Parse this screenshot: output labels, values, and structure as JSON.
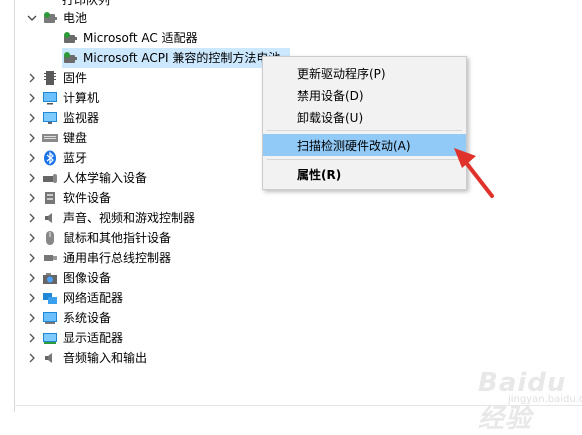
{
  "tree": {
    "cutoff_label": "打印队列",
    "battery": {
      "label": "电池",
      "children": [
        "Microsoft AC 适配器",
        "Microsoft ACPI 兼容的控制方法电池"
      ]
    },
    "categories": [
      {
        "label": "固件",
        "icon": "firmware-icon"
      },
      {
        "label": "计算机",
        "icon": "computer-icon"
      },
      {
        "label": "监视器",
        "icon": "monitor-icon"
      },
      {
        "label": "键盘",
        "icon": "keyboard-icon"
      },
      {
        "label": "蓝牙",
        "icon": "bluetooth-icon"
      },
      {
        "label": "人体学输入设备",
        "icon": "hid-icon"
      },
      {
        "label": "软件设备",
        "icon": "software-device-icon"
      },
      {
        "label": "声音、视频和游戏控制器",
        "icon": "speaker-icon"
      },
      {
        "label": "鼠标和其他指针设备",
        "icon": "mouse-icon"
      },
      {
        "label": "通用串行总线控制器",
        "icon": "usb-icon"
      },
      {
        "label": "图像设备",
        "icon": "camera-icon"
      },
      {
        "label": "网络适配器",
        "icon": "network-icon"
      },
      {
        "label": "系统设备",
        "icon": "system-device-icon"
      },
      {
        "label": "显示适配器",
        "icon": "display-adapter-icon"
      },
      {
        "label": "音频输入和输出",
        "icon": "audio-icon"
      }
    ]
  },
  "context_menu": {
    "items": [
      {
        "label": "更新驱动程序(P)"
      },
      {
        "label": "禁用设备(D)"
      },
      {
        "label": "卸载设备(U)"
      },
      {
        "label": "扫描检测硬件改动(A)"
      },
      {
        "label": "属性(R)"
      }
    ]
  },
  "watermark": {
    "main": "Baidu经验",
    "sub": "jingyan.baidu.com"
  },
  "colors": {
    "selection": "#cce8ff",
    "menu_highlight": "#91c9f7",
    "arrow": "#e0312b"
  }
}
